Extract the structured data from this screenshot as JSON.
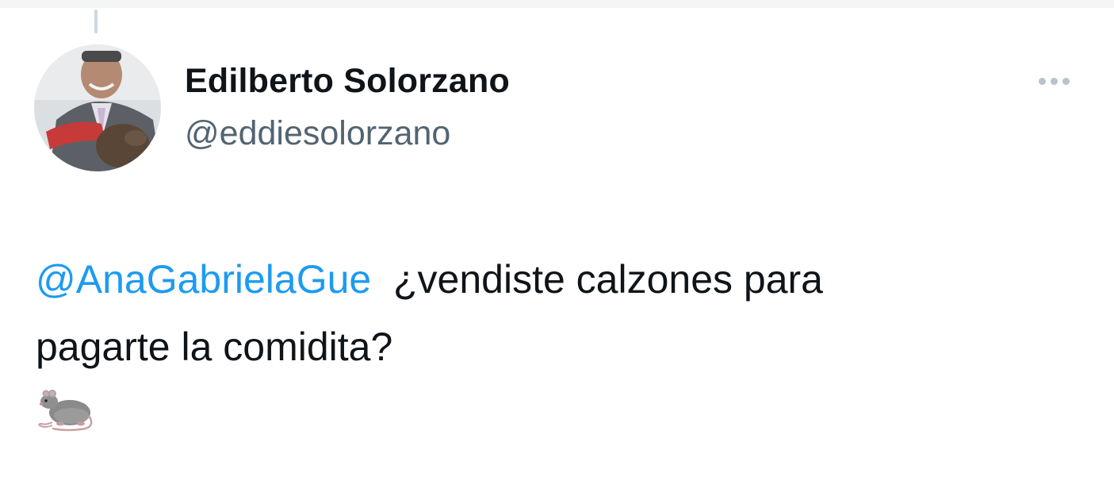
{
  "tweet": {
    "author_name": "Edilberto Solorzano",
    "author_handle": "@eddiesolorzano",
    "mention": "@AnaGabrielaGue",
    "text_line1": "¿vendiste calzones para",
    "text_line2": "pagarte la comidita?",
    "emoji": "rat-emoji"
  },
  "icons": {
    "more": "more-options-icon",
    "avatar": "profile-avatar"
  },
  "colors": {
    "mention": "#1d9bf0",
    "name": "#0f1419",
    "handle": "#536471",
    "more_dots": "#b9c3cb"
  }
}
